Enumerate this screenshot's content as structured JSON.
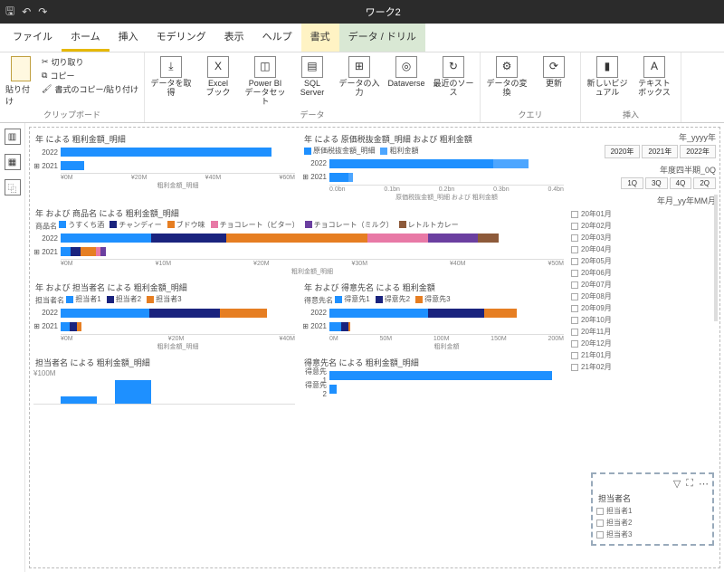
{
  "titlebar": {
    "title": "ワーク2"
  },
  "menu": {
    "tabs": [
      "ファイル",
      "ホーム",
      "挿入",
      "モデリング",
      "表示",
      "ヘルプ",
      "書式",
      "データ / ドリル"
    ],
    "active": 1
  },
  "ribbon": {
    "clipboard": {
      "paste": "貼り付け",
      "cut": "切り取り",
      "copy": "コピー",
      "format": "書式のコピー/貼り付け",
      "label": "クリップボード"
    },
    "data": {
      "getdata": "データを取得",
      "excel": "Excel\nブック",
      "pbids": "Power BI\nデータセット",
      "sql": "SQL\nServer",
      "enter": "データの入力",
      "dataverse": "Dataverse",
      "recent": "最近のソース",
      "label": "データ"
    },
    "query": {
      "transform": "データの変換",
      "refresh": "更新",
      "label": "クエリ"
    },
    "insert": {
      "visual": "新しいビジュアル",
      "textbox": "テキスト\nボックス",
      "label": "挿入"
    }
  },
  "charts": {
    "c1": {
      "title": "年 による 粗利金額_明細",
      "xticks": [
        "¥0M",
        "¥20M",
        "¥40M",
        "¥60M"
      ],
      "xlabel": "粗利金額_明細",
      "rows": [
        {
          "label": "2022",
          "segs": [
            {
              "cls": "c-blue",
              "w": 90
            }
          ]
        },
        {
          "label": "2021",
          "segs": [
            {
              "cls": "c-blue",
              "w": 10
            }
          ]
        }
      ]
    },
    "c2": {
      "title": "年 による 原価税抜金額_明細 および 粗利金額",
      "legend": [
        {
          "sw": "c-blue",
          "t": "原価税抜金額_明細"
        },
        {
          "sw": "c-lightblue",
          "t": "粗利金額"
        }
      ],
      "xticks": [
        "0.0bn",
        "0.1bn",
        "0.2bn",
        "0.3bn",
        "0.4bn"
      ],
      "xlabel": "原価税抜金額_明細 および 粗利金額",
      "rows": [
        {
          "label": "2022",
          "segs": [
            {
              "cls": "c-blue",
              "w": 70
            },
            {
              "cls": "c-lightblue",
              "w": 15
            }
          ]
        },
        {
          "label": "2021",
          "segs": [
            {
              "cls": "c-blue",
              "w": 8
            },
            {
              "cls": "c-lightblue",
              "w": 2
            }
          ]
        }
      ]
    },
    "c3": {
      "title": "年 および 商品名 による 粗利金額_明細",
      "legendLabel": "商品名",
      "legend": [
        {
          "sw": "c-blue",
          "t": "うすくち酒"
        },
        {
          "sw": "c-navy",
          "t": "チャンディー"
        },
        {
          "sw": "c-orange",
          "t": "ブドウ味"
        },
        {
          "sw": "c-pink",
          "t": "チョコレート（ビター）"
        },
        {
          "sw": "c-purple",
          "t": "チョコレート（ミルク）"
        },
        {
          "sw": "c-brown",
          "t": "レトルトカレー"
        }
      ],
      "xticks": [
        "¥0M",
        "¥10M",
        "¥20M",
        "¥30M",
        "¥40M",
        "¥50M"
      ],
      "xlabel": "粗利金額_明細",
      "rows": [
        {
          "label": "2022",
          "segs": [
            {
              "cls": "c-blue",
              "w": 18
            },
            {
              "cls": "c-navy",
              "w": 15
            },
            {
              "cls": "c-orange",
              "w": 28
            },
            {
              "cls": "c-pink",
              "w": 12
            },
            {
              "cls": "c-purple",
              "w": 10
            },
            {
              "cls": "c-brown",
              "w": 4
            }
          ]
        },
        {
          "label": "2021",
          "segs": [
            {
              "cls": "c-blue",
              "w": 2
            },
            {
              "cls": "c-navy",
              "w": 2
            },
            {
              "cls": "c-orange",
              "w": 3
            },
            {
              "cls": "c-pink",
              "w": 1
            },
            {
              "cls": "c-purple",
              "w": 1
            }
          ]
        }
      ]
    },
    "c4": {
      "title": "年 および 担当者名 による 粗利金額_明細",
      "legendLabel": "担当者名",
      "legend": [
        {
          "sw": "c-blue",
          "t": "担当者1"
        },
        {
          "sw": "c-navy",
          "t": "担当者2"
        },
        {
          "sw": "c-orange",
          "t": "担当者3"
        }
      ],
      "xticks": [
        "¥0M",
        "¥20M",
        "¥40M"
      ],
      "xlabel": "粗利金額_明細",
      "rows": [
        {
          "label": "2022",
          "segs": [
            {
              "cls": "c-blue",
              "w": 38
            },
            {
              "cls": "c-navy",
              "w": 30
            },
            {
              "cls": "c-orange",
              "w": 20
            }
          ]
        },
        {
          "label": "2021",
          "segs": [
            {
              "cls": "c-blue",
              "w": 4
            },
            {
              "cls": "c-navy",
              "w": 3
            },
            {
              "cls": "c-orange",
              "w": 2
            }
          ]
        }
      ]
    },
    "c5": {
      "title": "年 および 得意先名 による 粗利金額",
      "legendLabel": "得意先名",
      "legend": [
        {
          "sw": "c-blue",
          "t": "得意先1"
        },
        {
          "sw": "c-navy",
          "t": "得意先2"
        },
        {
          "sw": "c-orange",
          "t": "得意先3"
        }
      ],
      "xticks": [
        "0M",
        "50M",
        "100M",
        "150M",
        "200M"
      ],
      "xlabel": "粗利金額",
      "rows": [
        {
          "label": "2022",
          "segs": [
            {
              "cls": "c-blue",
              "w": 42
            },
            {
              "cls": "c-navy",
              "w": 24
            },
            {
              "cls": "c-orange",
              "w": 14
            }
          ]
        },
        {
          "label": "2021",
          "segs": [
            {
              "cls": "c-blue",
              "w": 5
            },
            {
              "cls": "c-navy",
              "w": 3
            },
            {
              "cls": "c-orange",
              "w": 1
            }
          ]
        }
      ]
    },
    "c6": {
      "title": "担当者名 による 粗利金額_明細",
      "ylabel": "¥100M"
    },
    "c7": {
      "title": "得意先名 による 粗利金額_明細",
      "rows": [
        {
          "label": "得意先1",
          "segs": [
            {
              "cls": "c-blue",
              "w": 95
            }
          ]
        },
        {
          "label": "得意先2",
          "segs": [
            {
              "cls": "c-blue",
              "w": 3
            }
          ]
        }
      ]
    }
  },
  "slicers": {
    "year": {
      "title": "年_yyyy年",
      "opts": [
        "2020年",
        "2021年",
        "2022年"
      ]
    },
    "quarter": {
      "title": "年度四半期_0Q",
      "opts": [
        "1Q",
        "3Q",
        "4Q",
        "2Q"
      ]
    },
    "month": {
      "title": "年月_yy年MM月",
      "opts": [
        "20年01月",
        "20年02月",
        "20年03月",
        "20年04月",
        "20年05月",
        "20年06月",
        "20年07月",
        "20年08月",
        "20年09月",
        "20年10月",
        "20年11月",
        "20年12月",
        "21年01月",
        "21年02月"
      ]
    },
    "person": {
      "title": "担当者名",
      "opts": [
        "担当者1",
        "担当者2",
        "担当者3"
      ]
    }
  },
  "chart_data": [
    {
      "type": "bar",
      "title": "年 による 粗利金額_明細",
      "categories": [
        "2022",
        "2021"
      ],
      "values": [
        55000000,
        6000000
      ],
      "xlabel": "粗利金額_明細",
      "xlim": [
        0,
        60000000
      ]
    },
    {
      "type": "bar",
      "title": "年 による 原価税抜金額_明細 および 粗利金額",
      "categories": [
        "2022",
        "2021"
      ],
      "series": [
        {
          "name": "原価税抜金額_明細",
          "values": [
            280000000,
            32000000
          ]
        },
        {
          "name": "粗利金額",
          "values": [
            60000000,
            8000000
          ]
        }
      ],
      "xlim": [
        0,
        400000000
      ]
    },
    {
      "type": "bar",
      "title": "年 および 商品名 による 粗利金額_明細",
      "categories": [
        "2022",
        "2021"
      ],
      "series": [
        {
          "name": "うすくち酒",
          "values": [
            9000000,
            1000000
          ]
        },
        {
          "name": "チャンディー",
          "values": [
            8000000,
            1000000
          ]
        },
        {
          "name": "ブドウ味",
          "values": [
            14000000,
            1500000
          ]
        },
        {
          "name": "チョコレート（ビター）",
          "values": [
            6000000,
            500000
          ]
        },
        {
          "name": "チョコレート（ミルク）",
          "values": [
            5000000,
            500000
          ]
        },
        {
          "name": "レトルトカレー",
          "values": [
            2000000,
            0
          ]
        }
      ],
      "xlim": [
        0,
        50000000
      ]
    },
    {
      "type": "bar",
      "title": "年 および 担当者名 による 粗利金額_明細",
      "categories": [
        "2022",
        "2021"
      ],
      "series": [
        {
          "name": "担当者1",
          "values": [
            19000000,
            2000000
          ]
        },
        {
          "name": "担当者2",
          "values": [
            15000000,
            1500000
          ]
        },
        {
          "name": "担当者3",
          "values": [
            10000000,
            1000000
          ]
        }
      ],
      "xlim": [
        0,
        50000000
      ]
    },
    {
      "type": "bar",
      "title": "年 および 得意先名 による 粗利金額",
      "categories": [
        "2022",
        "2021"
      ],
      "series": [
        {
          "name": "得意先1",
          "values": [
            84000000,
            10000000
          ]
        },
        {
          "name": "得意先2",
          "values": [
            48000000,
            6000000
          ]
        },
        {
          "name": "得意先3",
          "values": [
            28000000,
            2000000
          ]
        }
      ],
      "xlim": [
        0,
        200000000
      ]
    },
    {
      "type": "bar",
      "title": "担当者名 による 粗利金額_明細",
      "ylabel": "¥100M"
    },
    {
      "type": "bar",
      "title": "得意先名 による 粗利金額_明細",
      "categories": [
        "得意先1",
        "得意先2"
      ],
      "values": [
        95,
        3
      ]
    }
  ]
}
